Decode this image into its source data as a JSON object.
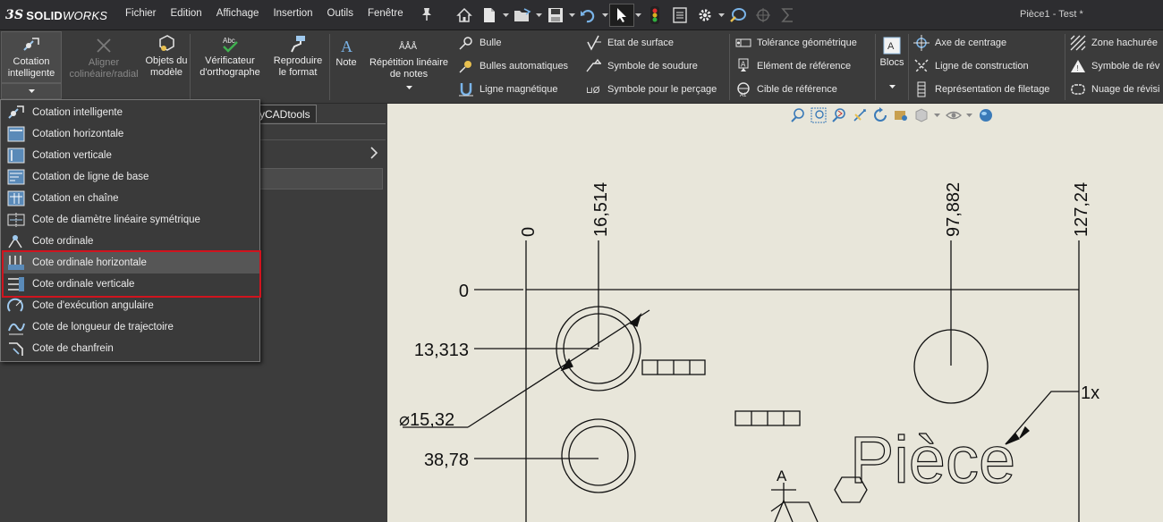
{
  "app": {
    "brand_prefix": "3S",
    "brand_bold": "SOLID",
    "brand_rest": "WORKS",
    "doc_title": "Pièce1 - Test *"
  },
  "menu": [
    "Fichier",
    "Edition",
    "Affichage",
    "Insertion",
    "Outils",
    "Fenêtre"
  ],
  "ribbon": {
    "cotation": "Cotation intelligente",
    "aligner": "Aligner colinéaire/radial",
    "objets": "Objets du modèle",
    "verificateur": "Vérificateur d'orthographe",
    "reproduire": "Reproduire le format",
    "note": "Note",
    "repetition": "Répétition linéaire de notes",
    "bulle": "Bulle",
    "bulles_auto": "Bulles automatiques",
    "ligne_magnetique": "Ligne magnétique",
    "etat_surface": "Etat de surface",
    "symbole_soudure": "Symbole de soudure",
    "symbole_percage": "Symbole pour le perçage",
    "tolerance": "Tolérance géométrique",
    "element_ref": "Elément de référence",
    "cible_ref": "Cible de référence",
    "blocs": "Blocs",
    "axe_centrage": "Axe de centrage",
    "ligne_construction": "Ligne de construction",
    "filetage": "Représentation de filetage",
    "zone_hachuree": "Zone hachurée",
    "symbole_rev": "Symbole de rév",
    "nuage_rev": "Nuage de révisi"
  },
  "panel": {
    "tab_label": "yCADtools"
  },
  "dropdown": {
    "items": [
      "Cotation intelligente",
      "Cotation horizontale",
      "Cotation verticale",
      "Cotation de ligne de base",
      "Cotation en chaîne",
      "Cote de diamètre linéaire symétrique",
      "Cote ordinale",
      "Cote ordinale horizontale",
      "Cote ordinale verticale",
      "Cote d'exécution angulaire",
      "Cote de longueur de trajectoire",
      "Cote de chanfrein"
    ],
    "highlighted_index": 7
  },
  "drawing": {
    "ordinate_x": [
      "0",
      "16,514",
      "97,882",
      "127,24"
    ],
    "ordinate_y": [
      "0",
      "13,313",
      "38,78"
    ],
    "diameter": "⌀15,32",
    "count_label": "1x",
    "datum": "A",
    "text": "Pièce"
  },
  "colors": {
    "highlight_frame": "#d0141e",
    "sheet": "#e8e6da",
    "ui_dark": "#3c3c3c"
  }
}
